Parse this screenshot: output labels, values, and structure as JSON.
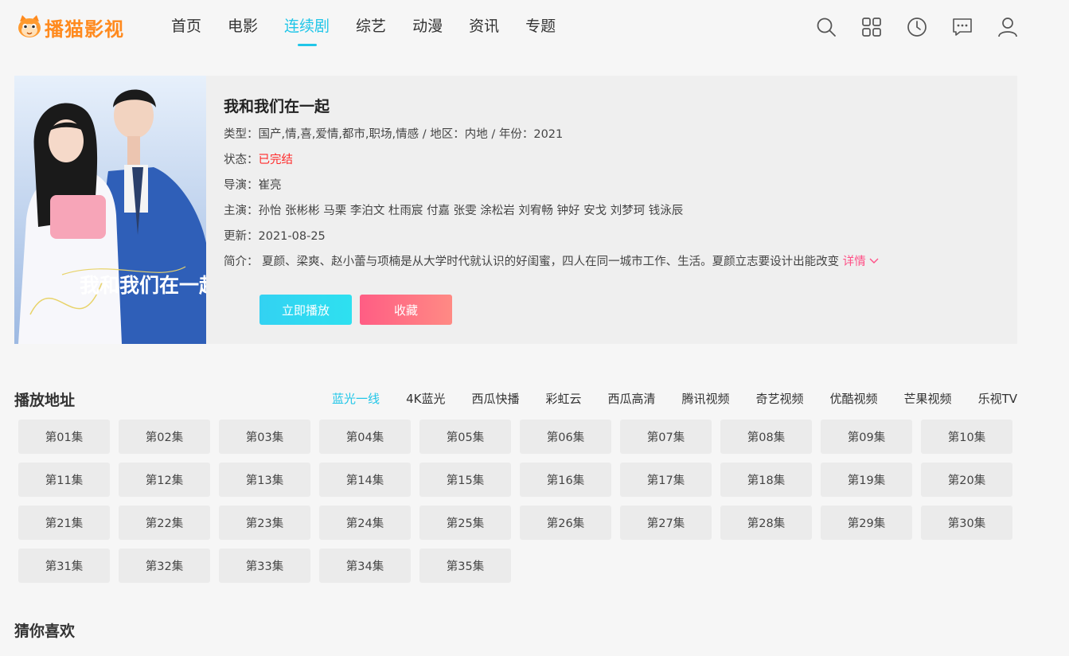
{
  "logo": {
    "text": "播猫影视"
  },
  "nav": [
    {
      "label": "首页",
      "active": false
    },
    {
      "label": "电影",
      "active": false
    },
    {
      "label": "连续剧",
      "active": true
    },
    {
      "label": "综艺",
      "active": false
    },
    {
      "label": "动漫",
      "active": false
    },
    {
      "label": "资讯",
      "active": false
    },
    {
      "label": "专题",
      "active": false
    }
  ],
  "tools": [
    "search-icon",
    "grid-icon",
    "history-icon",
    "message-icon",
    "user-icon"
  ],
  "detail": {
    "poster_title": "我和我们在一起",
    "title": "我和我们在一起",
    "type_line": "类型：国产,情,喜,爱情,都市,职场,情感 / 地区：内地 / 年份：2021",
    "status_label": "状态：",
    "status_value": "已完结",
    "director_line": "导演：崔亮",
    "cast_line": "主演：孙怡 张彬彬 马栗 李泊文 杜雨宸 付嘉 张雯 涂松岩 刘宥畅 钟好 安戈 刘梦珂 钱泳辰",
    "update_line": "更新：2021-08-25",
    "intro_label": "简介：",
    "intro_text": "夏颜、梁爽、赵小蕾与项楠是从大学时代就认识的好闺蜜，四人在同一城市工作、生活。夏颜立志要设计出能改变",
    "more_label": "详情",
    "play_button": "立即播放",
    "fav_button": "收藏"
  },
  "play_section": {
    "title": "播放地址",
    "sources": [
      {
        "label": "蓝光一线",
        "active": true
      },
      {
        "label": "4K蓝光",
        "active": false
      },
      {
        "label": "西瓜快播",
        "active": false
      },
      {
        "label": "彩虹云",
        "active": false
      },
      {
        "label": "西瓜高清",
        "active": false
      },
      {
        "label": "腾讯视频",
        "active": false
      },
      {
        "label": "奇艺视频",
        "active": false
      },
      {
        "label": "优酷视频",
        "active": false
      },
      {
        "label": "芒果视频",
        "active": false
      },
      {
        "label": "乐视TV",
        "active": false
      }
    ],
    "episodes": [
      "第01集",
      "第02集",
      "第03集",
      "第04集",
      "第05集",
      "第06集",
      "第07集",
      "第08集",
      "第09集",
      "第10集",
      "第11集",
      "第12集",
      "第13集",
      "第14集",
      "第15集",
      "第16集",
      "第17集",
      "第18集",
      "第19集",
      "第20集",
      "第21集",
      "第22集",
      "第23集",
      "第24集",
      "第25集",
      "第26集",
      "第27集",
      "第28集",
      "第29集",
      "第30集",
      "第31集",
      "第32集",
      "第33集",
      "第34集",
      "第35集"
    ]
  },
  "recommend": {
    "title": "猜你喜欢"
  },
  "colors": {
    "accent": "#21c6e8",
    "status": "#ff2a2a",
    "fav": "#ff5d84",
    "logo": "#ff8a1e"
  }
}
